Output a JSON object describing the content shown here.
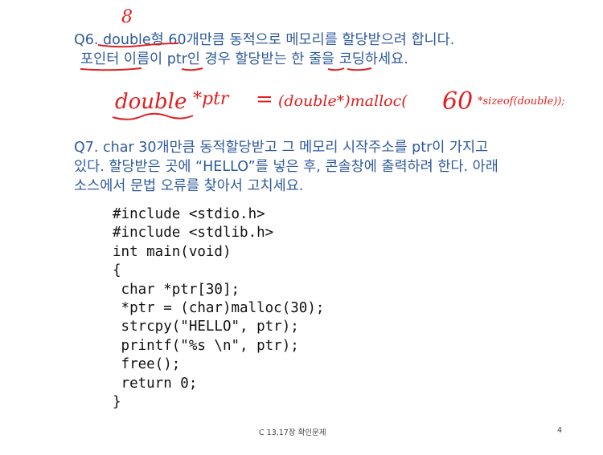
{
  "q6": {
    "line1": "Q6. double형 60개만큼 동적으로 메모리를 할당받으려 합니다.",
    "line2": "포인터 이름이 ptr인 경우 할당받는 한 줄을 코딩하세요."
  },
  "annotation": {
    "number": "8",
    "answer_part1": "double",
    "answer_part2": "*ptr",
    "answer_part3": "=",
    "answer_part4": "(double*)malloc(",
    "answer_part5": "60",
    "answer_part6": "*sizeof(double));"
  },
  "q7": {
    "line1": "Q7. char 30개만큼 동적할당받고 그 메모리 시작주소를 ptr이 가지고",
    "line2": "있다. 할당받은 곳에 “HELLO”를 넣은 후, 콘솔창에 출력하려 한다. 아래",
    "line3": "소스에서 문법 오류를 찾아서 고치세요."
  },
  "code": [
    "#include <stdio.h>",
    "#include <stdlib.h>",
    "int main(void)",
    "{",
    " char *ptr[30];",
    " *ptr = (char)malloc(30);",
    " strcpy(\"HELLO\", ptr);",
    " printf(\"%s \\n\", ptr);",
    " free();",
    " return 0;",
    "}"
  ],
  "footer": {
    "title": "C 13,17장 확인문제",
    "page": "4"
  },
  "colors": {
    "question_text": "#2e5a9c",
    "handwriting": "#e02020",
    "code_text": "#111111"
  }
}
